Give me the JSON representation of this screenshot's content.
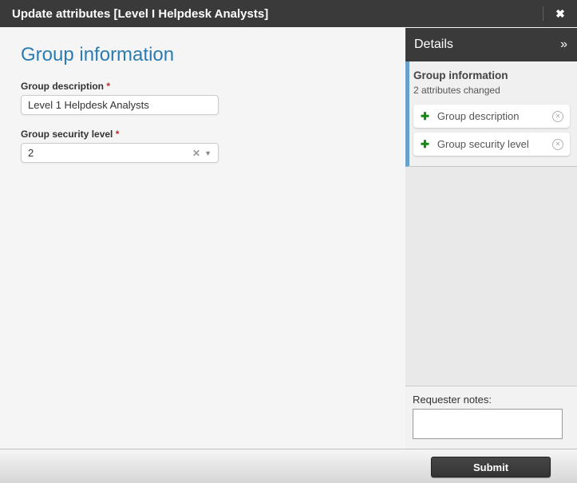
{
  "titlebar": {
    "title": "Update attributes [Level I Helpdesk Analysts]",
    "close_icon": "✖"
  },
  "form": {
    "heading": "Group information",
    "fields": [
      {
        "label": "Group description",
        "required_mark": "*",
        "value": "Level 1 Helpdesk Analysts"
      },
      {
        "label": "Group security level",
        "required_mark": "*",
        "value": "2",
        "clear_icon": "✕",
        "caret_icon": "▼"
      }
    ]
  },
  "details_panel": {
    "header": "Details",
    "collapse_icon": "»",
    "section_title": "Group information",
    "change_count_text": "2 attributes changed",
    "changes": [
      {
        "add_icon": "✚",
        "label": "Group description",
        "remove_icon": "✕"
      },
      {
        "add_icon": "✚",
        "label": "Group security level",
        "remove_icon": "✕"
      }
    ],
    "requester_notes_label": "Requester notes:",
    "requester_notes_value": ""
  },
  "footer": {
    "submit_label": "Submit"
  },
  "colors": {
    "titlebar_bg": "#3a3a3a",
    "heading_blue": "#2b7cb2",
    "accent_stripe_blue": "#68a1c9",
    "added_plus_green": "#178717",
    "required_red": "#b23030",
    "submit_bg": "#3a3a3a",
    "main_bg": "#f5f5f5",
    "sidebar_filler_bg": "#e9e9e9"
  }
}
